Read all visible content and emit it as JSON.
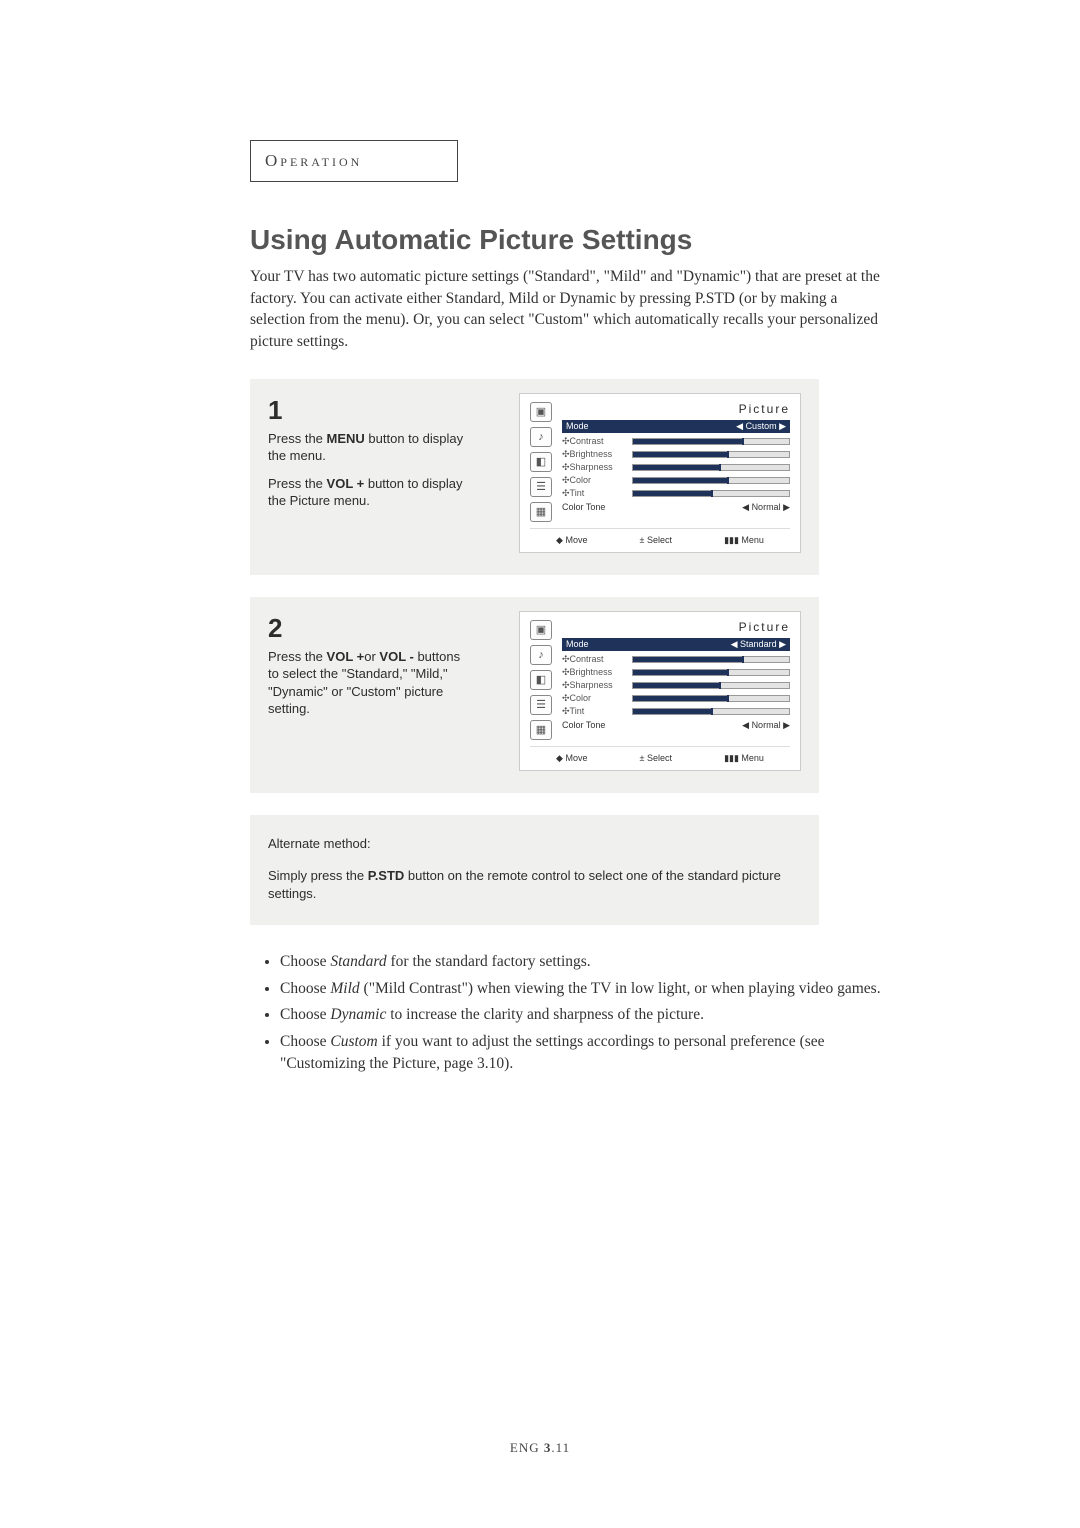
{
  "section_label": "Operation",
  "heading": "Using Automatic Picture Settings",
  "intro": "Your TV has two automatic picture settings (\"Standard\", \"Mild\" and \"Dynamic\") that are preset at the factory.  You can activate either Standard, Mild or Dynamic by pressing P.STD (or by making a selection from the menu). Or, you can select \"Custom\" which automatically recalls your personalized picture settings.",
  "step1": {
    "num": "1",
    "line1a": "Press the ",
    "line1b": "MENU",
    "line1c": " button to display the menu.",
    "line2a": "Press the ",
    "line2b": "VOL +",
    "line2c": " button to display the Picture menu."
  },
  "step2": {
    "num": "2",
    "a": "Press the ",
    "b": "VOL +",
    "c": "or ",
    "d": "VOL -",
    "e": " buttons to select the \"Standard,\" \"Mild,\" \"Dynamic\" or \"Custom\" picture setting."
  },
  "osd": {
    "title": "Picture",
    "mode_label": "Mode",
    "mode_val1": "Custom",
    "mode_val2": "Standard",
    "rows": [
      "Contrast",
      "Brightness",
      "Sharpness",
      "Color",
      "Tint"
    ],
    "color_tone_label": "Color Tone",
    "color_tone_val": "Normal",
    "footer": {
      "move": "Move",
      "select": "Select",
      "menu": "Menu"
    },
    "icons": [
      "▣",
      "♪",
      "◧",
      "☰",
      "▦"
    ]
  },
  "alt": {
    "heading": "Alternate method:",
    "a": "Simply press the ",
    "b": "P.STD",
    "c": " button on the remote control to select one of the standard picture settings."
  },
  "bullets": {
    "b1a": "Choose ",
    "b1b": "Standard",
    "b1c": " for the standard factory settings.",
    "b2a": "Choose ",
    "b2b": "Mild",
    "b2c": " (\"Mild Contrast\") when viewing the TV in low light, or when playing video games.",
    "b3a": "Choose ",
    "b3b": "Dynamic",
    "b3c": " to increase the clarity and sharpness of the picture.",
    "b4a": "Choose ",
    "b4b": "Custom",
    "b4c": " if you want to adjust the settings accordings to personal preference (see \"Customizing the Picture, page 3.10)."
  },
  "footer": {
    "lang": "ENG ",
    "page": "3",
    "rest": ".11"
  },
  "chart_data": {
    "type": "bar",
    "note": "Visual approximation of slider fill levels in Picture OSD (percent of bar)",
    "categories": [
      "Contrast",
      "Brightness",
      "Sharpness",
      "Color",
      "Tint"
    ],
    "values": [
      70,
      60,
      55,
      60,
      50
    ]
  }
}
